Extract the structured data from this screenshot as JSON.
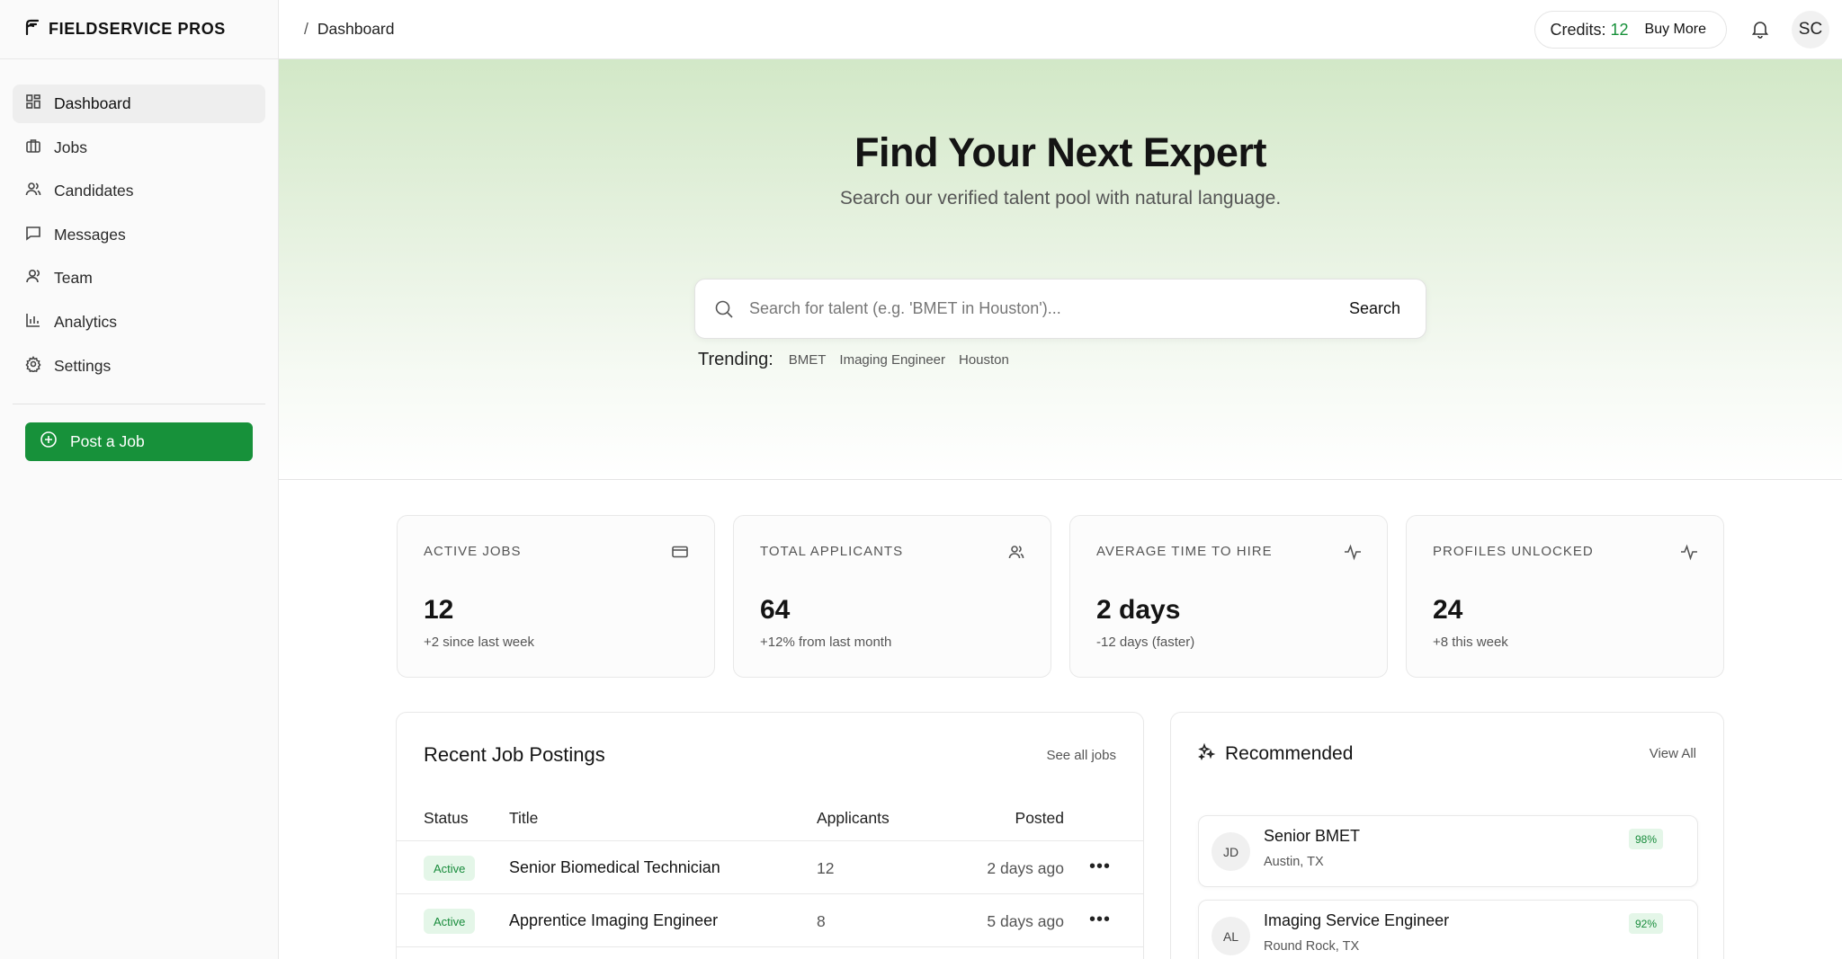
{
  "brand": {
    "name": "FIELDSERVICE PROS"
  },
  "sidebar": {
    "items": [
      {
        "label": "Dashboard",
        "icon": "grid-icon",
        "active": true
      },
      {
        "label": "Jobs",
        "icon": "briefcase-icon"
      },
      {
        "label": "Candidates",
        "icon": "users-icon"
      },
      {
        "label": "Messages",
        "icon": "message-icon"
      },
      {
        "label": "Team",
        "icon": "user-group-icon"
      },
      {
        "label": "Analytics",
        "icon": "bar-chart-icon"
      },
      {
        "label": "Settings",
        "icon": "gear-icon"
      }
    ],
    "post_job_label": "Post a Job"
  },
  "topbar": {
    "breadcrumb_sep": "/",
    "breadcrumb": "Dashboard",
    "credits_label": "Credits:",
    "credits_count": "12",
    "buy_more": "Buy More",
    "user_initials": "SC"
  },
  "hero": {
    "title": "Find Your Next Expert",
    "subtitle": "Search our verified talent pool with natural language.",
    "search_placeholder": "Search for talent (e.g. 'BMET in Houston')...",
    "search_button": "Search",
    "trending_label": "Trending:",
    "trending": [
      "BMET",
      "Imaging Engineer",
      "Houston"
    ]
  },
  "stats": [
    {
      "label": "ACTIVE JOBS",
      "value": "12",
      "note": "+2 since last week",
      "icon": "card-icon"
    },
    {
      "label": "TOTAL APPLICANTS",
      "value": "64",
      "note": "+12% from last month",
      "icon": "users-icon"
    },
    {
      "label": "AVERAGE TIME TO HIRE",
      "value": "2 days",
      "note": "-12 days (faster)",
      "icon": "activity-icon"
    },
    {
      "label": "PROFILES UNLOCKED",
      "value": "24",
      "note": "+8 this week",
      "icon": "activity-icon"
    }
  ],
  "jobs": {
    "title": "Recent Job Postings",
    "see_all": "See all jobs",
    "headers": {
      "status": "Status",
      "title": "Title",
      "applicants": "Applicants",
      "posted": "Posted"
    },
    "rows": [
      {
        "status": "Active",
        "title": "Senior Biomedical Technician",
        "applicants": "12",
        "posted": "2 days ago"
      },
      {
        "status": "Active",
        "title": "Apprentice Imaging Engineer",
        "applicants": "8",
        "posted": "5 days ago"
      }
    ]
  },
  "recommended": {
    "title": "Recommended",
    "view_all": "View All",
    "items": [
      {
        "initials": "JD",
        "name": "Senior BMET",
        "location": "Austin, TX",
        "score": "98%"
      },
      {
        "initials": "AL",
        "name": "Imaging Service Engineer",
        "location": "Round Rock, TX",
        "score": "92%"
      }
    ]
  },
  "colors": {
    "accent": "#17913a",
    "hero_top": "#d2e8c7",
    "badge_bg": "#e4f6e8"
  }
}
